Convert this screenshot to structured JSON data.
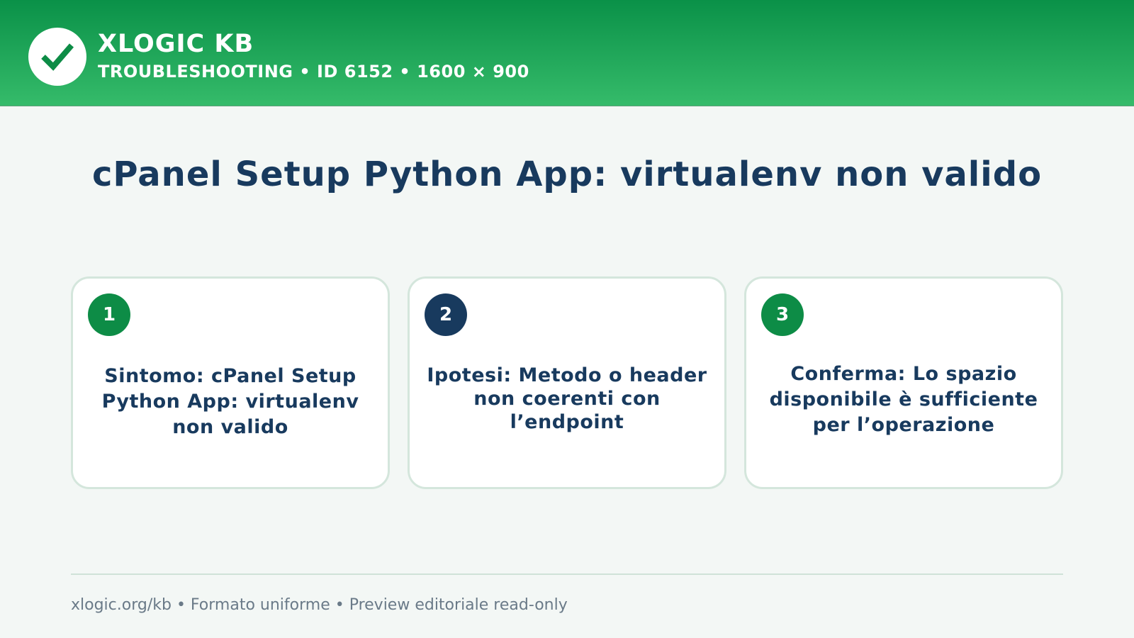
{
  "header": {
    "brand": "XLOGIC KB",
    "subtitle": "TROUBLESHOOTING • ID 6152 • 1600 × 900",
    "logo_icon": "checkmark-icon"
  },
  "main": {
    "title": "cPanel Setup Python App: virtualenv non valido"
  },
  "cards": [
    {
      "number": "1",
      "text": "Sintomo: cPanel Setup Python App: virtualenv non valido",
      "badge_color": "#0d8c46"
    },
    {
      "number": "2",
      "text": "Ipotesi: Metodo o header non coerenti con l’endpoint",
      "badge_color": "#183a5e"
    },
    {
      "number": "3",
      "text": "Conferma: Lo spazio disponibile è sufficiente per l’operazione",
      "badge_color": "#0d8c46"
    }
  ],
  "footer": {
    "text": "xlogic.org/kb • Formato uniforme • Preview editoriale read-only"
  },
  "colors": {
    "header_gradient_top": "#0a9148",
    "header_gradient_bottom": "#35bb6a",
    "title_color": "#183a5e",
    "background": "#f3f7f5",
    "card_border": "#d4e6dc"
  }
}
